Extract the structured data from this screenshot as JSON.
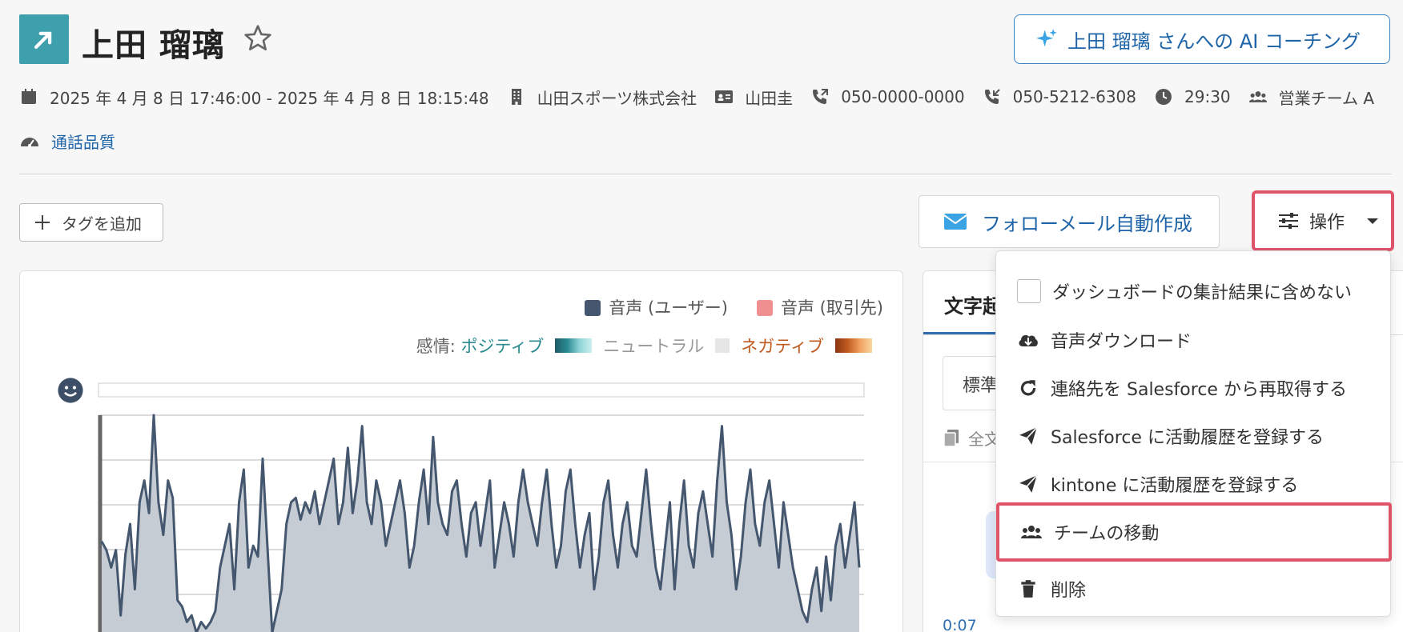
{
  "header": {
    "title": "上田 瑠璃",
    "ai_coaching_label": "上田 瑠璃 さんへの AI コーチング"
  },
  "meta": {
    "datetime": "2025 年 4 月 8 日 17:46:00 - 2025 年 4 月 8 日 18:15:48",
    "company": "山田スポーツ株式会社",
    "contact": "山田圭",
    "outgoing_phone": "050-0000-0000",
    "incoming_phone": "050-5212-6308",
    "duration": "29:30",
    "team": "営業チーム A",
    "call_quality": "通話品質"
  },
  "toolbar": {
    "add_tag": "タグを追加",
    "follow_mail": "フォローメール自動作成",
    "operations": "操作"
  },
  "chart_legend": {
    "user": "音声 (ユーザー)",
    "client": "音声 (取引先)",
    "sentiment_label": "感情:",
    "positive": "ポジティブ",
    "neutral": "ニュートラル",
    "negative": "ネガティブ"
  },
  "colors": {
    "user_series": "#44576e",
    "client_series": "#ef8f8f",
    "accent": "#1e64a8",
    "highlight": "#e0546a",
    "positive": "#2b8a92",
    "negative": "#c05a1f"
  },
  "chart_data": {
    "type": "area",
    "series": [
      {
        "name": "音声 (ユーザー)",
        "values": [
          0.42,
          0.38,
          0.3,
          0.38,
          0.08,
          0.36,
          0.5,
          0.2,
          0.6,
          0.7,
          0.55,
          1.0,
          0.6,
          0.45,
          0.7,
          0.62,
          0.15,
          0.12,
          0.05,
          0.08,
          0.0,
          0.05,
          0.02,
          0.05,
          0.1,
          0.3,
          0.4,
          0.5,
          0.2,
          0.6,
          0.75,
          0.3,
          0.4,
          0.35,
          0.8,
          0.4,
          0.0,
          0.1,
          0.2,
          0.5,
          0.6,
          0.62,
          0.52,
          0.6,
          0.55,
          0.65,
          0.5,
          0.6,
          0.7,
          0.8,
          0.5,
          0.6,
          0.85,
          0.55,
          0.7,
          0.95,
          0.6,
          0.5,
          0.7,
          0.6,
          0.4,
          0.5,
          0.6,
          0.7,
          0.55,
          0.3,
          0.4,
          0.6,
          0.75,
          0.5,
          0.9,
          0.6,
          0.5,
          0.45,
          0.65,
          0.7,
          0.5,
          0.35,
          0.55,
          0.6,
          0.4,
          0.55,
          0.7,
          0.3,
          0.45,
          0.6,
          0.5,
          0.35,
          0.6,
          0.75,
          0.6,
          0.5,
          0.4,
          0.6,
          0.75,
          0.5,
          0.3,
          0.4,
          0.65,
          0.75,
          0.5,
          0.3,
          0.45,
          0.55,
          0.2,
          0.35,
          0.6,
          0.7,
          0.45,
          0.3,
          0.5,
          0.6,
          0.4,
          0.35,
          0.55,
          0.75,
          0.5,
          0.3,
          0.2,
          0.4,
          0.6,
          0.2,
          0.5,
          0.7,
          0.4,
          0.3,
          0.55,
          0.65,
          0.5,
          0.35,
          0.7,
          0.95,
          0.6,
          0.45,
          0.2,
          0.35,
          0.6,
          0.75,
          0.5,
          0.4,
          0.6,
          0.7,
          0.5,
          0.3,
          0.6,
          0.45,
          0.3,
          0.2,
          0.1,
          0.05,
          0.2,
          0.3,
          0.1,
          0.35,
          0.15,
          0.4,
          0.5,
          0.3,
          0.45,
          0.6,
          0.3
        ]
      }
    ],
    "ylim": [
      0,
      1
    ],
    "legend": "top-right",
    "grid": true
  },
  "right_panel": {
    "tab": "文字起",
    "select_value": "標準",
    "copy_label": "全文",
    "first_time": "0:07"
  },
  "menu": {
    "items": [
      {
        "label": "ダッシュボードの集計結果に含めない",
        "icon": "checkbox"
      },
      {
        "label": "音声ダウンロード",
        "icon": "cloud-download-icon"
      },
      {
        "label": "連絡先を Salesforce から再取得する",
        "icon": "redo-icon"
      },
      {
        "label": "Salesforce に活動履歴を登録する",
        "icon": "paper-plane-icon"
      },
      {
        "label": "kintone に活動履歴を登録する",
        "icon": "paper-plane-icon"
      },
      {
        "label": "チームの移動",
        "icon": "users-icon"
      },
      {
        "label": "削除",
        "icon": "trash-icon"
      }
    ]
  }
}
